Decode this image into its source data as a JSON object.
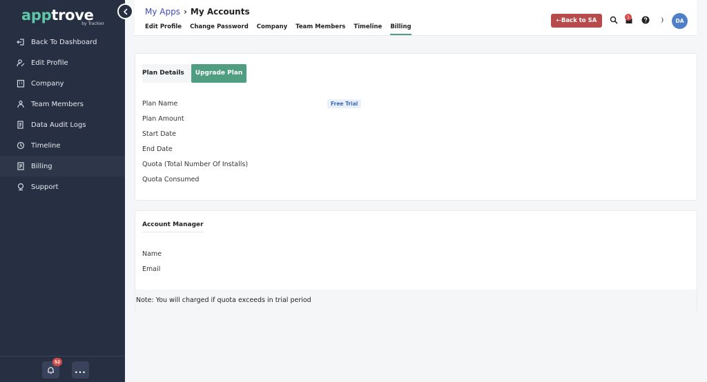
{
  "sidebar": {
    "logo_prefix": "app",
    "logo_suffix": "trove",
    "logo_sub": "by Trackier",
    "items": [
      {
        "label": "Back To Dashboard",
        "icon": "back-icon"
      },
      {
        "label": "Edit Profile",
        "icon": "edit-profile-icon"
      },
      {
        "label": "Company",
        "icon": "company-icon"
      },
      {
        "label": "Team Members",
        "icon": "team-icon"
      },
      {
        "label": "Data Audit Logs",
        "icon": "audit-log-icon"
      },
      {
        "label": "Timeline",
        "icon": "timeline-icon"
      },
      {
        "label": "Billing",
        "icon": "billing-icon"
      },
      {
        "label": "Support",
        "icon": "support-icon"
      }
    ],
    "notification_count": "52",
    "more_label": "..."
  },
  "header": {
    "breadcrumb_link": "My Apps",
    "breadcrumb_current": "My Accounts",
    "tabs": [
      "Edit Profile",
      "Change Password",
      "Company",
      "Team Members",
      "Timeline",
      "Billing"
    ],
    "active_tab": "Billing",
    "back_button": "⇠Back to SA",
    "cart_badge": "1",
    "avatar_initials": "DA"
  },
  "plan": {
    "tab_label": "Plan Details",
    "upgrade_label": "Upgrade Plan",
    "fields": [
      "Plan Name",
      "Plan Amount",
      "Start Date",
      "End Date",
      "Quota (Total Number Of Installs)",
      "Quota Consumed"
    ],
    "plan_name_value": "Free Trial"
  },
  "account_manager": {
    "title": "Account Manager",
    "fields": [
      "Name",
      "Email"
    ],
    "note": "Note: You will charged if quota exceeds in trial period"
  },
  "colors": {
    "sidebar_bg": "#273042",
    "accent_green": "#4f9e82",
    "back_button_red": "#b74a4a",
    "link_blue": "#3f4bb5"
  }
}
